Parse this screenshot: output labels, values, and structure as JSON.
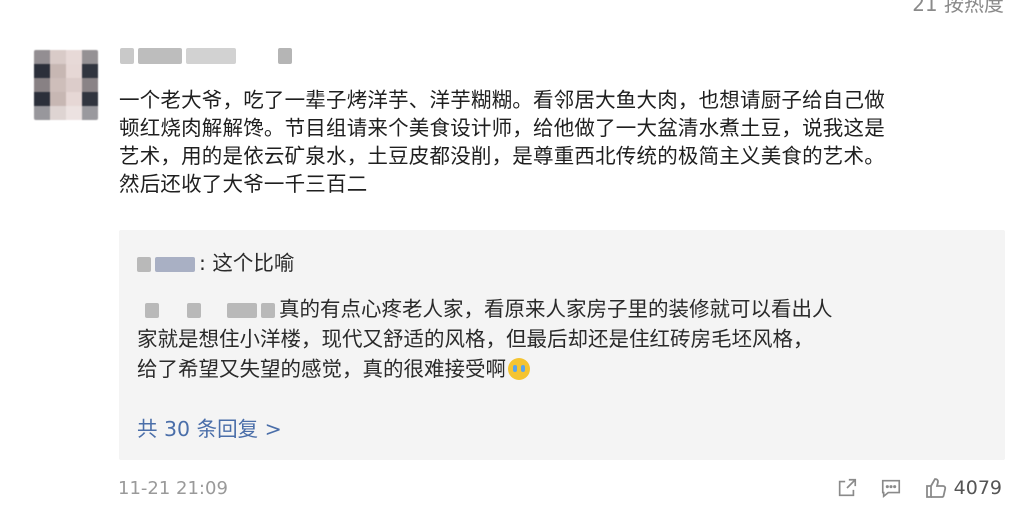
{
  "sort_label": "21 按热度",
  "comment": {
    "lines": [
      "一个老大爷，吃了一辈子烤洋芋、洋芋糊糊。看邻居大鱼大肉，也想请厨子给自己做",
      "顿红烧肉解解馋。节目组请来个美食设计师，给他做了一大盆清水煮土豆，说我这是",
      "艺术，用的是依云矿泉水，土豆皮都没削，是尊重西北传统的极简主义美食的艺术。",
      "然后还收了大爷一千三百二"
    ],
    "timestamp": "11-21 21:09",
    "likes": "4079"
  },
  "replies": {
    "reply1_text": ": 这个比喻",
    "reply2_lines": [
      "真的有点心疼老人家，看原来人家房子里的装修就可以看出人",
      "家就是想住小洋楼，现代又舒适的风格，但最后却还是住红砖房毛坯风格，",
      "给了希望又失望的感觉，真的很难接受啊"
    ],
    "more_label": "共 30 条回复 >"
  },
  "icons": [
    "share-icon",
    "reply-icon",
    "like-icon",
    "crying-emoji-icon"
  ],
  "colors": {
    "link": "#4a6ea9",
    "reply_bg": "#f4f4f4",
    "meta": "#9a9a9a"
  }
}
